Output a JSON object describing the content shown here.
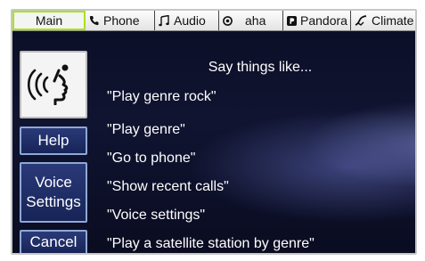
{
  "tabs": [
    {
      "label": "Main",
      "icon": null,
      "active": true
    },
    {
      "label": "Phone",
      "icon": "phone-icon",
      "active": false
    },
    {
      "label": "Audio",
      "icon": "music-note-icon",
      "active": false
    },
    {
      "label": "aha",
      "icon": "aha-logo-icon",
      "active": false
    },
    {
      "label": "Pandora",
      "icon": "pandora-logo-icon",
      "active": false
    },
    {
      "label": "Climate",
      "icon": "climate-fan-icon",
      "active": false
    }
  ],
  "left_panel": {
    "voice_icon": "speaking-head-icon",
    "help_label": "Help",
    "voice_settings_line1": "Voice",
    "voice_settings_line2": "Settings",
    "cancel_label": "Cancel"
  },
  "prompt": {
    "title": "Say things like...",
    "phrases": [
      "\"Play genre rock\"",
      "\"Play genre\"",
      "\"Go to phone\"",
      "\"Show recent calls\"",
      "\"Voice settings\"",
      "\"Play a satellite station by genre\""
    ]
  },
  "colors": {
    "active_tab_border": "#aee01f",
    "button_fill": "#1f2e6b",
    "background": "#0c0f26"
  }
}
